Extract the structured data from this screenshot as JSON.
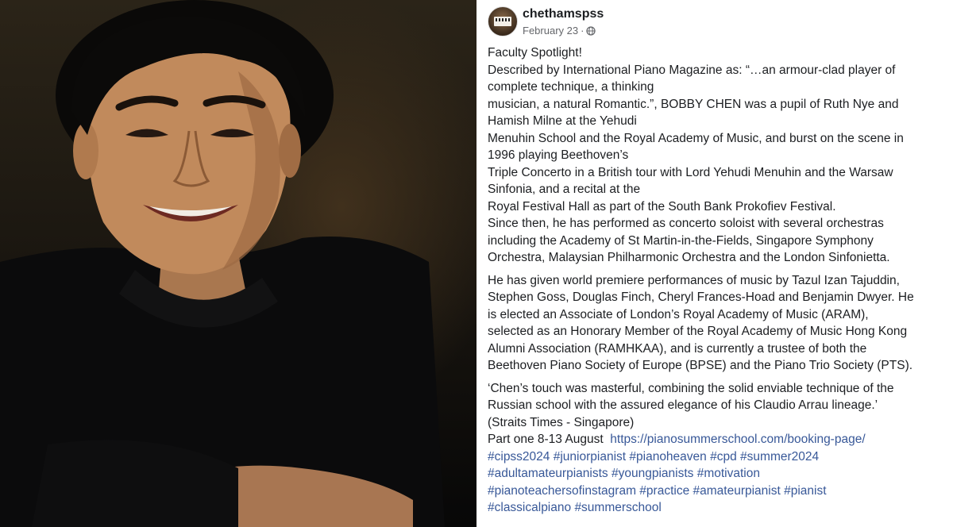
{
  "post": {
    "username": "chethamspss",
    "date": "February 23",
    "separator": "·",
    "icons": {
      "avatar": "piano-avatar",
      "audience": "globe-icon"
    },
    "lines_block1": [
      "Faculty Spotlight!",
      "Described by International Piano Magazine as: “…an armour-clad player of",
      "complete technique, a thinking",
      "musician, a natural Romantic.”, BOBBY CHEN was a pupil of Ruth Nye and",
      "Hamish Milne at the Yehudi",
      "Menuhin School and the Royal Academy of Music, and burst on the scene in",
      "1996 playing Beethoven’s",
      "Triple Concerto in a British tour with Lord Yehudi Menuhin and the Warsaw",
      "Sinfonia, and a recital at the",
      "Royal Festival Hall as part of the South Bank Prokofiev Festival.",
      "Since then, he has performed as concerto soloist with several orchestras",
      "including the Academy of St Martin-in-the-Fields, Singapore Symphony",
      "Orchestra, Malaysian Philharmonic Orchestra and the London Sinfonietta."
    ],
    "lines_block2": [
      "He has given world premiere performances of music by Tazul Izan Tajuddin,",
      "Stephen Goss, Douglas Finch, Cheryl Frances-Hoad and Benjamin Dwyer. He",
      "is elected an Associate of London’s Royal Academy of Music (ARAM),",
      "selected as an Honorary Member of the Royal Academy of Music Hong Kong",
      "Alumni Association (RAMHKAA), and is currently a trustee of both the",
      "Beethoven Piano Society of Europe (BPSE) and the Piano Trio Society (PTS)."
    ],
    "lines_block3": [
      "‘Chen’s touch was masterful, combining the solid enviable technique of the",
      "Russian school with the assured elegance of his Claudio Arrau lineage.’",
      "(Straits Times - Singapore)"
    ],
    "part_one_text": "Part one 8-13 August",
    "booking_link": "https://pianosummerschool.com/booking-page/",
    "hashtags": [
      [
        "#cipss2024",
        "#juniorpianist",
        "#pianoheaven",
        "#cpd",
        "#summer2024"
      ],
      [
        "#adultamateurpianists",
        "#youngpianists",
        "#motivation"
      ],
      [
        "#pianoteachersofinstagram",
        "#practice",
        "#amateurpianist",
        "#pianist"
      ],
      [
        "#classicalpiano",
        "#summerschool"
      ]
    ]
  },
  "colors": {
    "link": "#385898",
    "text": "#1c1e21",
    "meta": "#65676b"
  }
}
